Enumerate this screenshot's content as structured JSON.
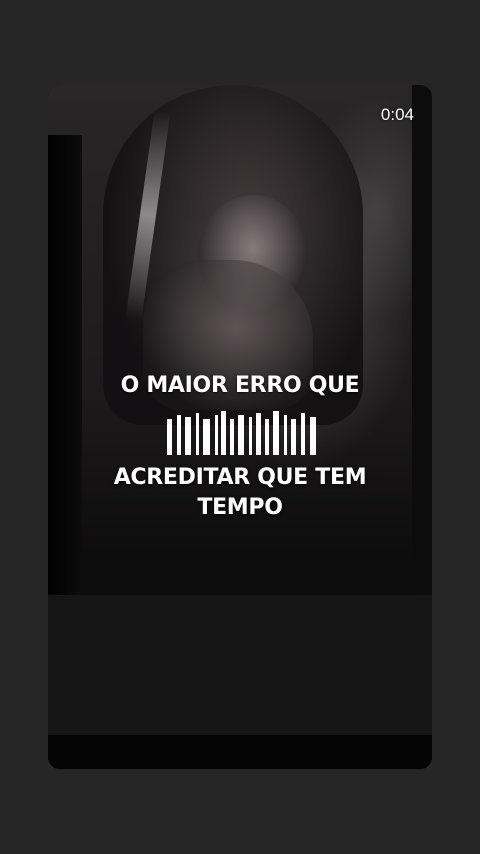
{
  "player": {
    "time": "0:04"
  },
  "captions": {
    "line1": "O MAIOR ERRO QUE",
    "line3": "ACREDITAR QUE TEM",
    "line4": "TEMPO"
  },
  "colors": {
    "background": "#262626",
    "text": "#ffffff"
  }
}
